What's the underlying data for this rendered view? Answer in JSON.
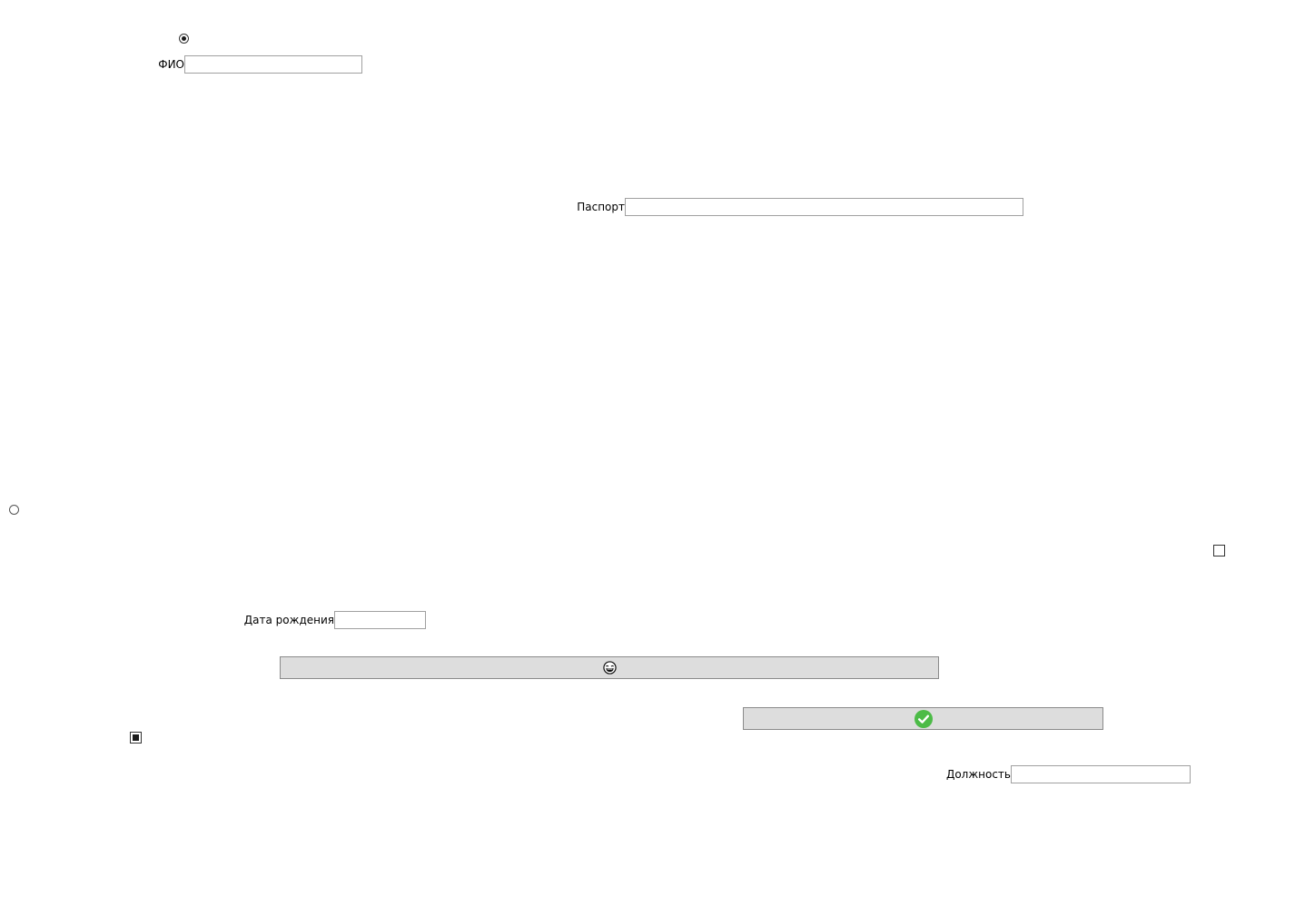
{
  "form": {
    "fio": {
      "label": "ФИО",
      "value": ""
    },
    "passport": {
      "label": "Паспорт",
      "value": ""
    },
    "birth_date": {
      "label": "Дата рождения",
      "value": ""
    },
    "position": {
      "label": "Должность",
      "value": ""
    }
  },
  "radios": [
    {
      "checked": true
    },
    {
      "checked": false
    }
  ],
  "checkboxes": [
    {
      "checked": false
    },
    {
      "checked": true
    }
  ],
  "buttons": {
    "emoji_button": {
      "icon": "laughing-face-icon"
    },
    "confirm_button": {
      "icon": "check-circle-icon",
      "icon_color": "#4cbb47"
    }
  },
  "colors": {
    "button_bg": "#dddddd",
    "button_border": "#8a8a8a",
    "input_border": "#a0a0a0"
  }
}
